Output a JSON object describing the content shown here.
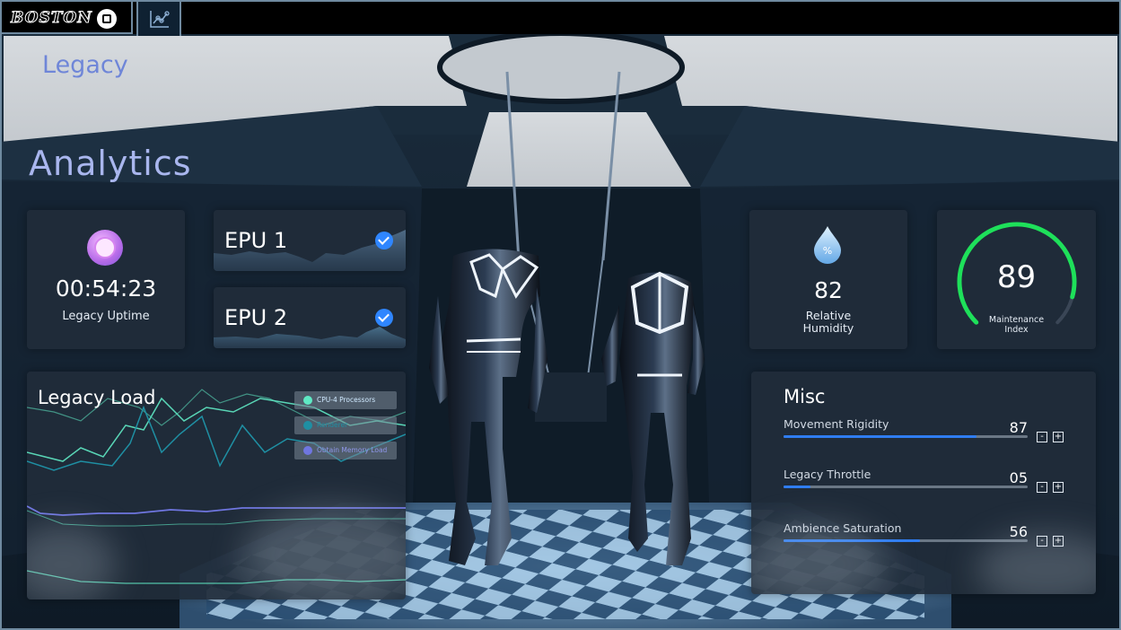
{
  "colors": {
    "accent_blue": "#2f86ff",
    "heading_blue": "#6f86d8",
    "gauge_green": "#1ee05a",
    "card_bg": "#202c3a"
  },
  "header": {
    "logo_text": "BOSTON",
    "home_icon": "square-home-icon",
    "analytics_tab_icon": "line-chart-icon"
  },
  "page": {
    "section_title": "Legacy",
    "title": "Analytics"
  },
  "uptime": {
    "icon": "clock-icon",
    "value": "00:54:23",
    "label": "Legacy Uptime"
  },
  "epus": [
    {
      "label": "EPU 1",
      "checked": true
    },
    {
      "label": "EPU 2",
      "checked": true
    }
  ],
  "humidity": {
    "icon": "water-drop-icon",
    "value": "82",
    "label": "Relative Humidity"
  },
  "maintenance": {
    "value": "89",
    "label": "Maintenance Index",
    "gauge_fraction": 0.89
  },
  "legacy_load": {
    "title": "Legacy Load",
    "legend": [
      {
        "label": "CPU-4 Processors",
        "color": "#5fe9c4"
      },
      {
        "label": "Renderer",
        "color": "#1f8fa3"
      },
      {
        "label": "Obtain Memory Load",
        "color": "#6f76e0"
      }
    ]
  },
  "misc": {
    "title": "Misc",
    "settings": [
      {
        "label": "Movement Rigidity",
        "value": "87",
        "fraction": 0.79
      },
      {
        "label": "Legacy Throttle",
        "value": "05",
        "fraction": 0.11
      },
      {
        "label": "Ambience Saturation",
        "value": "56",
        "fraction": 0.56
      }
    ],
    "minus_label": "-",
    "plus_label": "+"
  }
}
